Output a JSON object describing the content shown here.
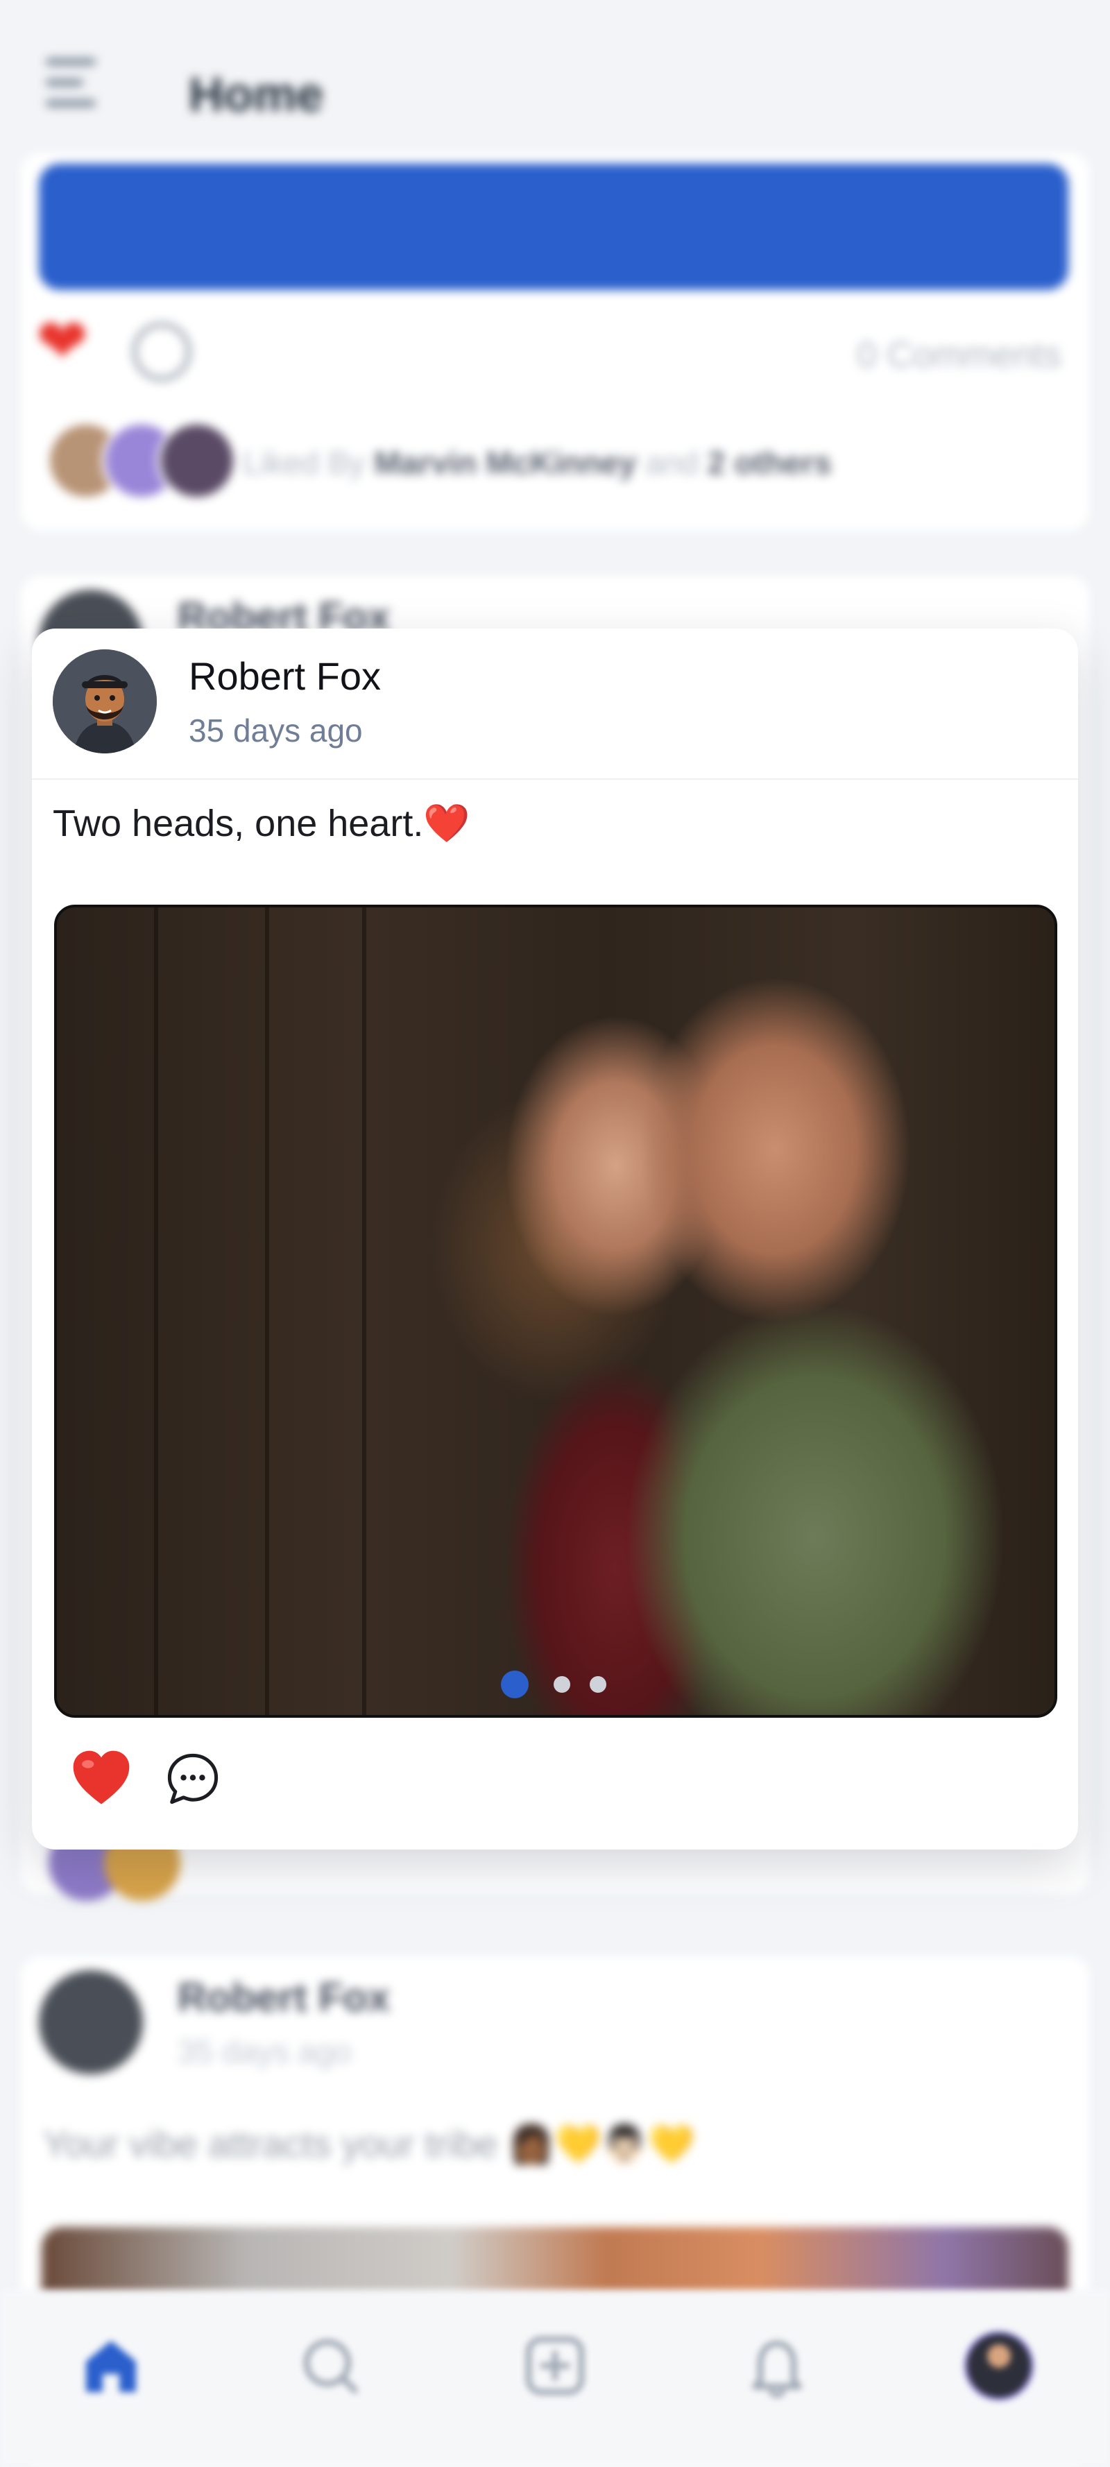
{
  "header": {
    "title": "Home"
  },
  "feed_top": {
    "comments_label": "0 Comments",
    "liked_prefix": "Liked By",
    "liked_name": "Marvin McKinney",
    "liked_and": "and",
    "liked_others": "2 others"
  },
  "post": {
    "author": "Robert Fox",
    "time": "35 days ago",
    "caption": "Two heads, one heart.",
    "caption_emoji": "❤️",
    "slides_total": 3,
    "active_slide": 1
  },
  "next_post": {
    "author": "Robert Fox",
    "time": "35 days ago",
    "caption": "Your vibe attracts your tribe 👩🏾💛👨🏻💛"
  },
  "bottom_nav": {
    "items": [
      "home-icon",
      "search-icon",
      "add-post-icon",
      "bell-icon",
      "profile-avatar"
    ],
    "active": "home-icon",
    "accent": "#2a5fcc"
  },
  "colors": {
    "accent": "#2a5fcc",
    "like": "#e8342c",
    "muted_text": "#6f7d96"
  }
}
